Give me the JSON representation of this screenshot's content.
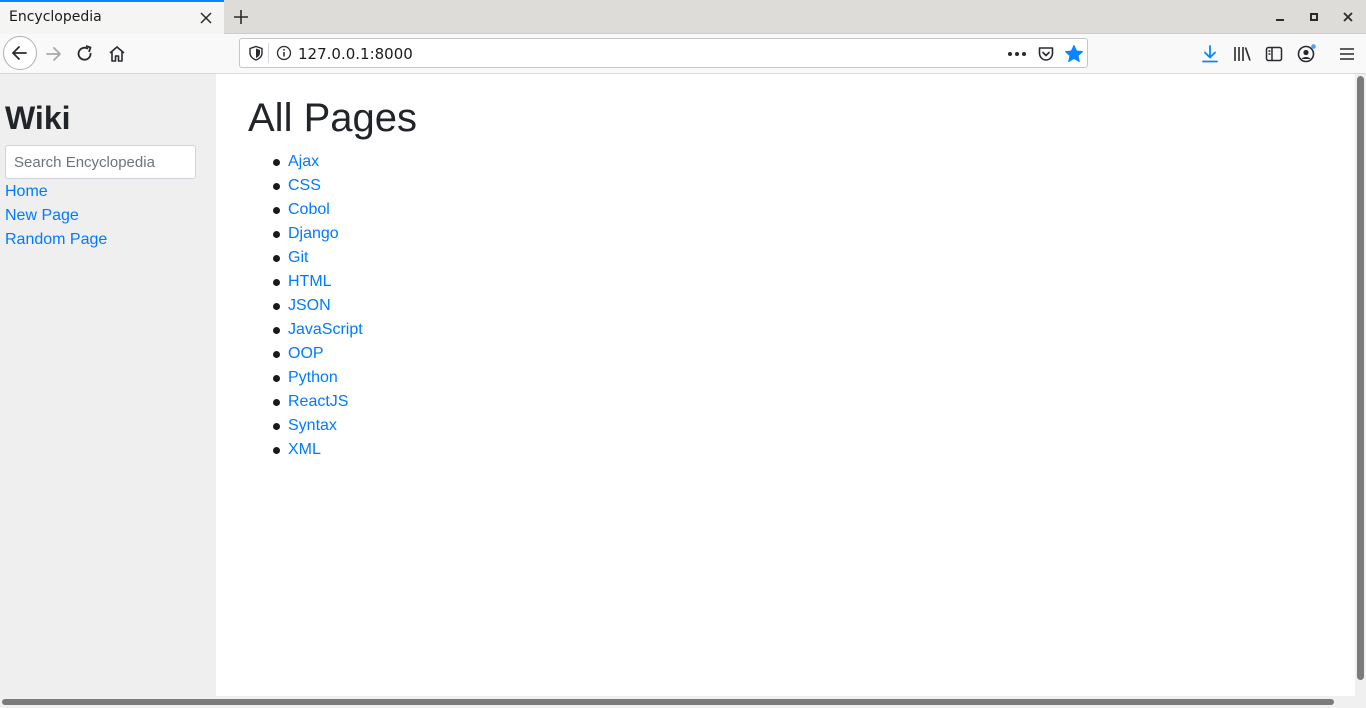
{
  "browser": {
    "tab_title": "Encyclopedia",
    "url": "127.0.0.1:8000",
    "accent_color": "#0a84ff",
    "icons": [
      "close-icon",
      "plus-icon",
      "minimize-icon",
      "maximize-icon",
      "back-icon",
      "forward-icon",
      "reload-icon",
      "home-icon",
      "shield-icon",
      "info-icon",
      "more-icon",
      "pocket-icon",
      "star-icon",
      "download-icon",
      "library-icon",
      "sidebar-icon",
      "account-icon",
      "menu-icon"
    ]
  },
  "sidebar": {
    "brand": "Wiki",
    "search_placeholder": "Search Encyclopedia",
    "links": [
      "Home",
      "New Page",
      "Random Page"
    ]
  },
  "main": {
    "title": "All Pages",
    "pages": [
      "Ajax",
      "CSS",
      "Cobol",
      "Django",
      "Git",
      "HTML",
      "JSON",
      "JavaScript",
      "OOP",
      "Python",
      "ReactJS",
      "Syntax",
      "XML"
    ]
  },
  "colors": {
    "link": "#007bff",
    "sidebar_bg": "#efefef",
    "text": "#212529"
  }
}
